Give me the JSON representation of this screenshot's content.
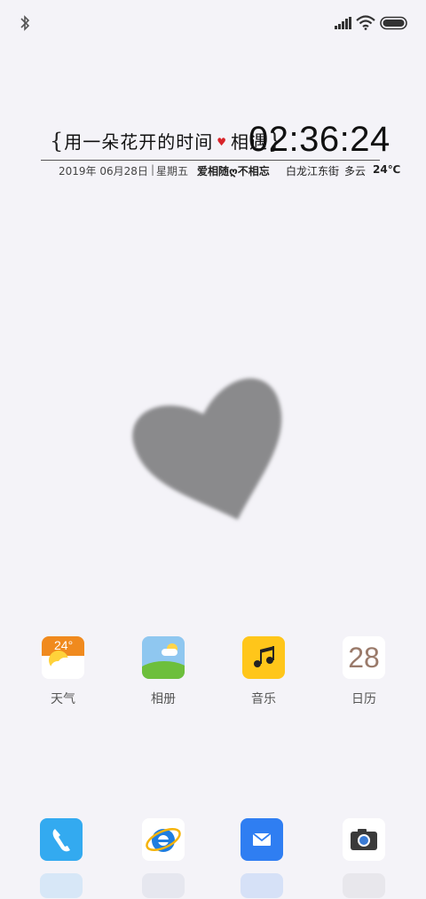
{
  "status_bar": {
    "icons": [
      "bluetooth-icon",
      "signal-icon",
      "wifi-icon",
      "battery-icon"
    ]
  },
  "widget": {
    "slogan_open": "{",
    "slogan_a": "用一朵花开的时间",
    "slogan_heart": "♥",
    "slogan_b": "相遇",
    "slogan_close": "}",
    "time": "02:36:24",
    "date": "2019年 06月28日",
    "separator": "|",
    "weekday": "星期五",
    "motto": "爱相随ღ不相忘",
    "location": "白龙江东街",
    "weather": "多云",
    "temperature": "24℃"
  },
  "apps": [
    {
      "label": "天气",
      "icon": "weather-icon",
      "icon_text": "24°"
    },
    {
      "label": "相册",
      "icon": "gallery-icon"
    },
    {
      "label": "音乐",
      "icon": "music-icon",
      "icon_text": "♪♫"
    },
    {
      "label": "日历",
      "icon": "calendar-icon",
      "icon_text": "28"
    }
  ],
  "dock": [
    {
      "icon": "phone-icon"
    },
    {
      "icon": "browser-icon"
    },
    {
      "icon": "mail-icon"
    },
    {
      "icon": "camera-icon"
    }
  ],
  "colors": {
    "background": "#f4f3f8",
    "heart_gray": "#8a8a8c",
    "weather_orange": "#f08a1e",
    "music_yellow": "#ffc61a",
    "phone_blue": "#33aaf0",
    "mail_blue": "#2f7ef2"
  }
}
